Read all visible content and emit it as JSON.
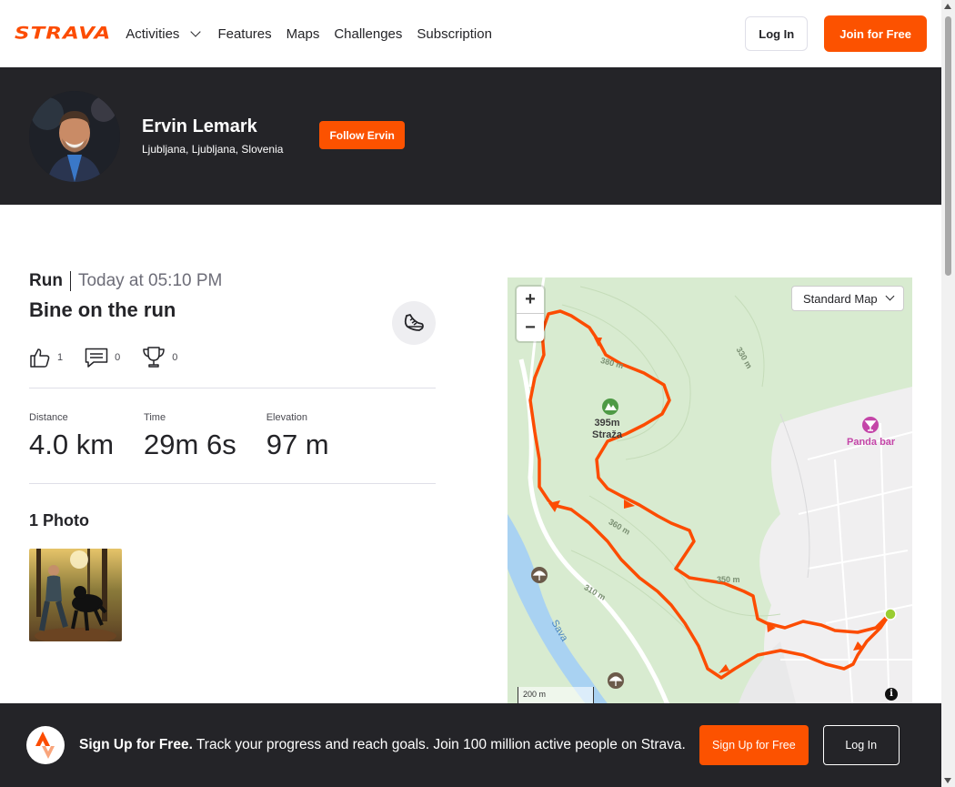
{
  "nav": {
    "logo": "STRAVA",
    "items": [
      {
        "label": "Activities",
        "has_dropdown": true
      },
      {
        "label": "Features"
      },
      {
        "label": "Maps"
      },
      {
        "label": "Challenges"
      },
      {
        "label": "Subscription"
      }
    ],
    "login_label": "Log In",
    "join_label": "Join for Free"
  },
  "profile": {
    "name": "Ervin Lemark",
    "location": "Ljubljana, Ljubljana, Slovenia",
    "follow_label": "Follow Ervin"
  },
  "activity": {
    "type": "Run",
    "when": "Today at 05:10 PM",
    "title": "Bine on the run",
    "kudos": "1",
    "comments": "0",
    "achievements": "0",
    "stats": [
      {
        "label": "Distance",
        "value": "4.0 km"
      },
      {
        "label": "Time",
        "value": "29m 6s"
      },
      {
        "label": "Elevation",
        "value": "97 m"
      }
    ],
    "photos_heading": "1 Photo"
  },
  "map": {
    "type_select": "Standard Map",
    "zoom_in": "+",
    "zoom_out": "−",
    "scale_label": "200 m",
    "info": "i",
    "peak_elevation": "395m",
    "peak_name": "Straža",
    "poi_bar": "Panda bar",
    "contours": [
      "380 m",
      "330 m",
      "360 m",
      "350 m",
      "310 m"
    ],
    "river": "Sava",
    "route_color": "#fc4c02"
  },
  "banner": {
    "lead": "Sign Up for Free.",
    "text": "Track your progress and reach goals. Join 100 million active people on Strava.",
    "signup_label": "Sign Up for Free",
    "login_label": "Log In"
  },
  "colors": {
    "brand": "#fc4c02",
    "dark": "#242428"
  }
}
